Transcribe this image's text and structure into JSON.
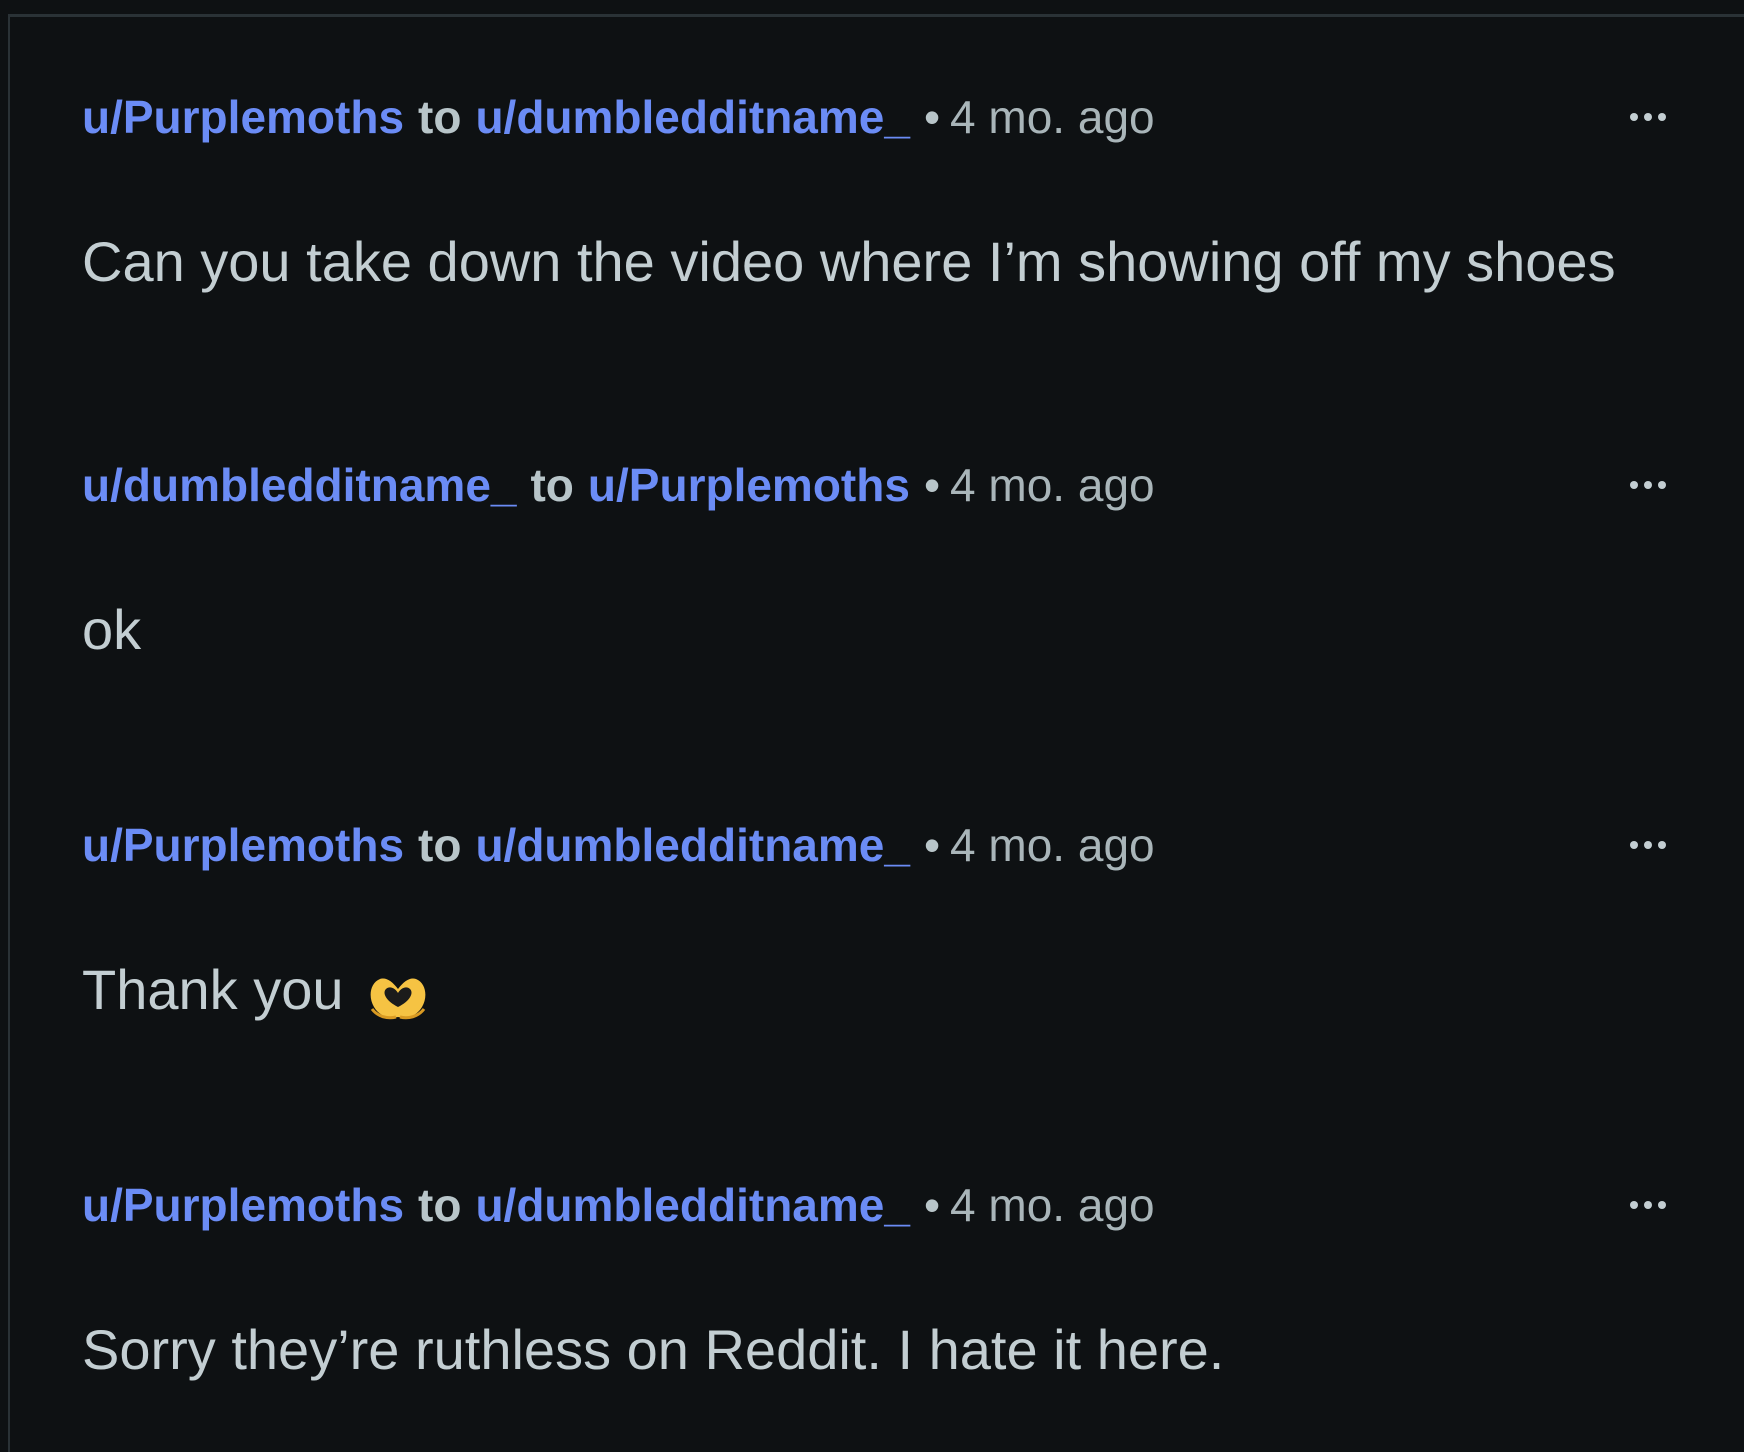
{
  "messages": [
    {
      "from": "u/Purplemoths",
      "connector": "to",
      "to": "u/dumbledditname_",
      "separator": "•",
      "time": "4 mo. ago",
      "text": "Can you take down the video where I’m showing off my shoes"
    },
    {
      "from": "u/dumbledditname_",
      "connector": "to",
      "to": "u/Purplemoths",
      "separator": "•",
      "time": "4 mo. ago",
      "text": "ok"
    },
    {
      "from": "u/Purplemoths",
      "connector": "to",
      "to": "u/dumbledditname_",
      "separator": "•",
      "time": "4 mo. ago",
      "text": "Thank you",
      "emoji_icon": "heart-hands-emoji-icon"
    },
    {
      "from": "u/Purplemoths",
      "connector": "to",
      "to": "u/dumbledditname_",
      "separator": "•",
      "time": "4 mo. ago",
      "text": "Sorry they’re ruthless on Reddit. I hate it here."
    }
  ],
  "icons": {
    "more": "more-options-icon"
  },
  "colors": {
    "background": "#0e1113",
    "username": "#6b8cf5",
    "text": "#c3ced2",
    "meta": "#a9b5b9"
  }
}
